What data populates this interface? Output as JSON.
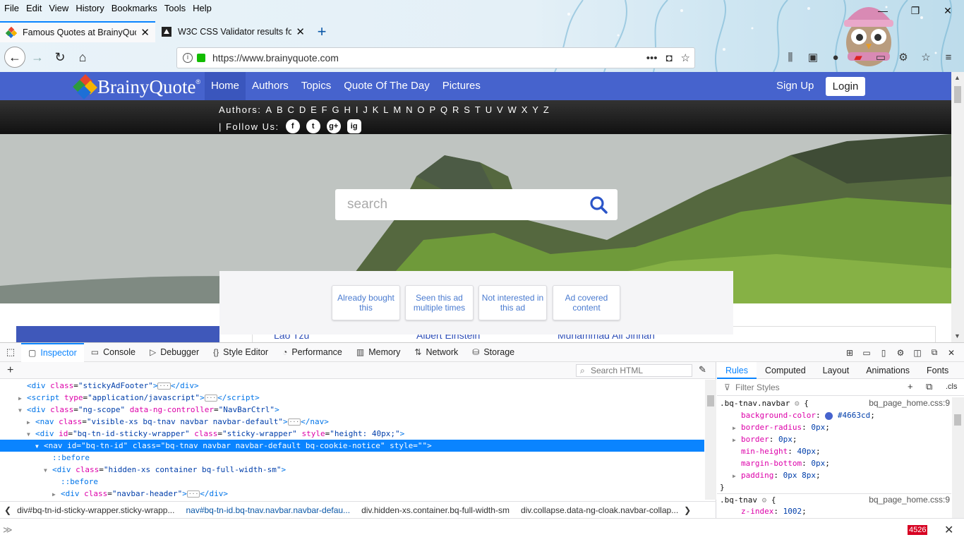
{
  "menubar": [
    "File",
    "Edit",
    "View",
    "History",
    "Bookmarks",
    "Tools",
    "Help"
  ],
  "window_controls": [
    "—",
    "❐",
    "✕"
  ],
  "tabs": [
    {
      "title": "Famous Quotes at BrainyQuote",
      "close": "✕"
    },
    {
      "title": "W3C CSS Validator results for bl",
      "close": "✕"
    }
  ],
  "new_tab": "+",
  "url": "https://www.brainyquote.com",
  "site": {
    "logo_text": "BrainyQuote",
    "logo_reg": "®",
    "menu": [
      "Home",
      "Authors",
      "Topics",
      "Quote Of The Day",
      "Pictures"
    ],
    "signup": "Sign Up",
    "login": "Login",
    "authors_label": "Authors:",
    "letters": [
      "A",
      "B",
      "C",
      "D",
      "E",
      "F",
      "G",
      "H",
      "I",
      "J",
      "K",
      "L",
      "M",
      "N",
      "O",
      "P",
      "Q",
      "R",
      "S",
      "T",
      "U",
      "V",
      "W",
      "X",
      "Y",
      "Z"
    ],
    "follow_label": "| Follow Us:",
    "social": [
      "f",
      "t",
      "g+",
      "ig"
    ],
    "search_placeholder": "search",
    "ad_buttons": [
      "Already bought this",
      "Seen this ad multiple times",
      "Not interested in this ad",
      "Ad covered content"
    ],
    "below_names": [
      "Lao Tzu",
      "Albert Einstein",
      "Muhammad Ali Jinnah"
    ]
  },
  "devtools": {
    "tabs": [
      {
        "label": "Inspector",
        "icon": "inspector-icon"
      },
      {
        "label": "Console",
        "icon": "console-icon"
      },
      {
        "label": "Debugger",
        "icon": "debugger-icon"
      },
      {
        "label": "Style Editor",
        "icon": "style-editor-icon"
      },
      {
        "label": "Performance",
        "icon": "performance-icon"
      },
      {
        "label": "Memory",
        "icon": "memory-icon"
      },
      {
        "label": "Network",
        "icon": "network-icon"
      },
      {
        "label": "Storage",
        "icon": "storage-icon"
      }
    ],
    "search_html": "Search HTML",
    "side_tabs": [
      "Rules",
      "Computed",
      "Layout",
      "Animations",
      "Fonts"
    ],
    "filter_placeholder": "Filter Styles",
    "cls": ".cls",
    "breadcrumbs": [
      "div#bq-tn-id-sticky-wrapper.sticky-wrapp...",
      "nav#bq-tn-id.bq-tnav.navbar.navbar-defau...",
      "div.hidden-xs.container.bq-full-width-sm",
      "div.collapse.data-ng-cloak.navbar-collap..."
    ],
    "error_count": "4526",
    "rule1": {
      "selector": ".bq-tnav.navbar",
      "source": "bq_page_home.css:9",
      "props": [
        {
          "name": "background-color",
          "value": "#4663cd",
          "swatch": "#4663cd"
        },
        {
          "name": "border-radius",
          "value": "0px"
        },
        {
          "name": "border",
          "value": "0px"
        },
        {
          "name": "min-height",
          "value": "40px"
        },
        {
          "name": "margin-bottom",
          "value": "0px"
        },
        {
          "name": "padding",
          "value": "0px 8px"
        }
      ]
    },
    "rule2": {
      "selector": ".bq-tnav",
      "source": "bq_page_home.css:9",
      "props": [
        {
          "name": "z-index",
          "value": "1002"
        }
      ]
    }
  },
  "colors": {
    "brand": "#4663cd",
    "accent": "#0a84ff"
  }
}
